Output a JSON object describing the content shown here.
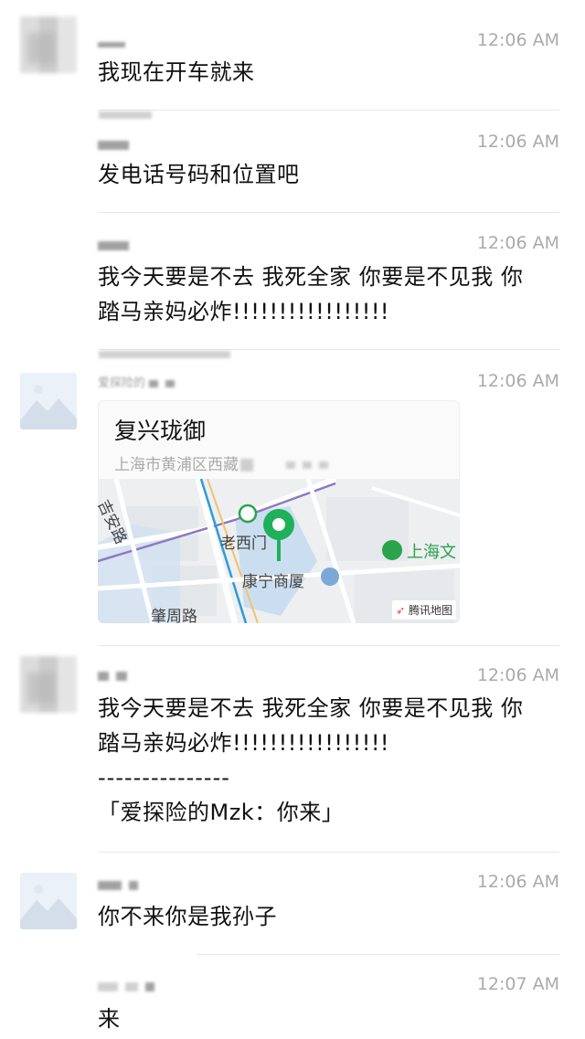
{
  "messages": [
    {
      "time": "12:06 AM",
      "text": "我现在开车就来"
    },
    {
      "time": "12:06 AM",
      "text": "发电话号码和位置吧"
    },
    {
      "time": "12:06 AM",
      "lines": [
        "我今天要是不去 我死全家 你要是不见我 你",
        "踏马亲妈必炸!!!!!!!!!!!!!!!!!"
      ]
    },
    {
      "time": "12:06 AM",
      "location": {
        "title": "复兴珑御",
        "address": "上海市黄浦区西藏",
        "map_labels": {
          "street1": "吉安路",
          "station": "老西门",
          "building": "康宁商厦",
          "poi": "上海文",
          "street2": "肇周路"
        },
        "map_provider": "腾讯地图"
      }
    },
    {
      "time": "12:06 AM",
      "lines": [
        "我今天要是不去 我死全家 你要是不见我 你",
        "踏马亲妈必炸!!!!!!!!!!!!!!!!!",
        "---------------",
        "「爱探险的Mzk：你来」"
      ]
    },
    {
      "time": "12:06 AM",
      "text": "你不来你是我孙子"
    },
    {
      "time": "12:07 AM",
      "text": "来"
    }
  ],
  "partial_name": "爱探险的",
  "colors": {
    "poi_green": "#2aa34a",
    "pin_green": "#1fb05a",
    "time_gray": "#aaaaaa"
  }
}
